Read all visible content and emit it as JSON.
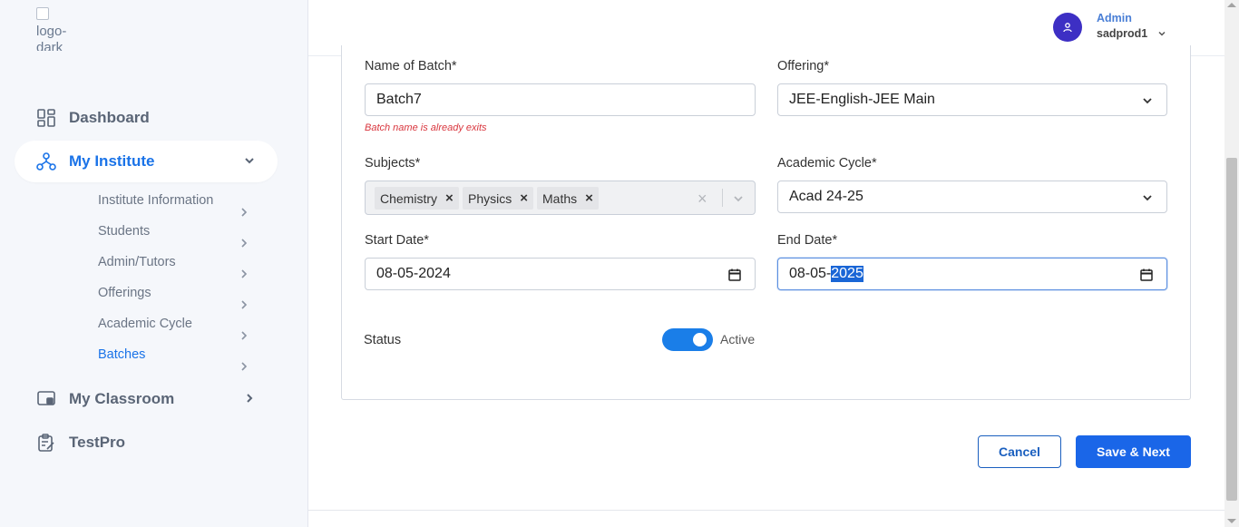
{
  "sidebar": {
    "logo_alt": "logo-dark",
    "items": [
      {
        "label": "Dashboard",
        "icon": "dashboard-grid-icon"
      },
      {
        "label": "My Institute",
        "icon": "org-chart-icon",
        "active": true
      },
      {
        "label": "My Classroom",
        "icon": "classroom-screen-icon"
      },
      {
        "label": "TestPro",
        "icon": "clipboard-edit-icon"
      }
    ],
    "sub_items": [
      {
        "label": "Institute Information"
      },
      {
        "label": "Students"
      },
      {
        "label": "Admin/Tutors"
      },
      {
        "label": "Offerings"
      },
      {
        "label": "Academic Cycle"
      },
      {
        "label": "Batches",
        "active": true
      }
    ]
  },
  "header": {
    "user_role": "Admin",
    "user_name": "sadprod1",
    "avatar_icon": "user-icon"
  },
  "form": {
    "batch_name": {
      "label": "Name of Batch*",
      "value": "Batch7",
      "error": "Batch name is already exits"
    },
    "offering": {
      "label": "Offering*",
      "value": "JEE-English-JEE Main"
    },
    "subjects": {
      "label": "Subjects*",
      "tags": [
        "Chemistry",
        "Physics",
        "Maths"
      ]
    },
    "academic_cycle": {
      "label": "Academic Cycle*",
      "value": "Acad 24-25"
    },
    "start_date": {
      "label": "Start Date*",
      "value": "08-05-2024"
    },
    "end_date": {
      "label": "End Date*",
      "value_prefix": "08-05-",
      "value_selected": "2025"
    },
    "status": {
      "label": "Status",
      "value": "Active",
      "on": true
    }
  },
  "actions": {
    "cancel": "Cancel",
    "save_next": "Save & Next"
  },
  "colors": {
    "primary": "#1a66e8",
    "error": "#d9363e",
    "avatar": "#3d2fc4",
    "sidebar_bg": "#f5f7fb"
  }
}
